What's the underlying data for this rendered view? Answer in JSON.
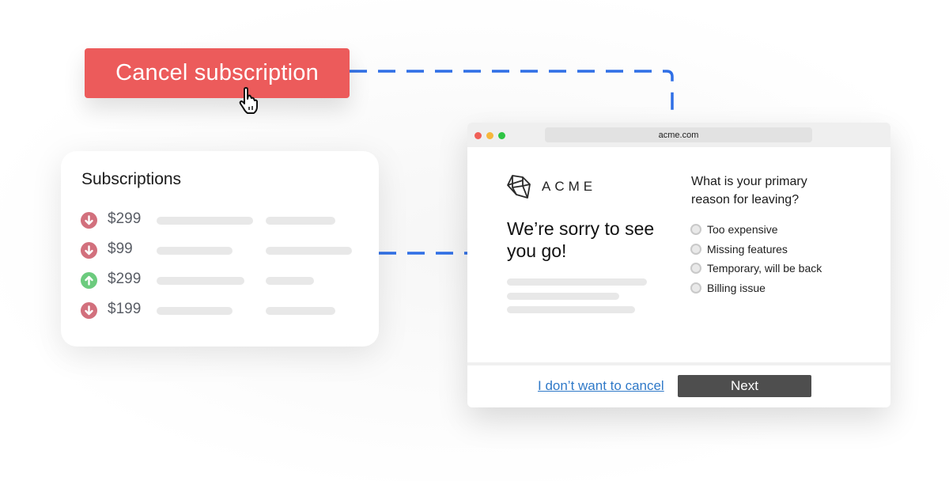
{
  "cta": {
    "cancel_label": "Cancel subscription",
    "color": "#ec5b5b"
  },
  "subscriptions": {
    "title": "Subscriptions",
    "rows": [
      {
        "direction": "down",
        "icon": "arrow-down-circle-icon",
        "price": "$299"
      },
      {
        "direction": "down",
        "icon": "arrow-down-circle-icon",
        "price": "$99"
      },
      {
        "direction": "up",
        "icon": "arrow-up-circle-icon",
        "price": "$299"
      },
      {
        "direction": "down",
        "icon": "arrow-down-circle-icon",
        "price": "$199"
      }
    ],
    "colors": {
      "down": "#d2707d",
      "up": "#6ccb7e"
    }
  },
  "browser": {
    "url": "acme.com",
    "window_controls": [
      "close",
      "minimize",
      "maximize"
    ],
    "brand": {
      "name": "ACME",
      "logo_icon": "polyhedron-logo-icon"
    },
    "headline": "We’re sorry to see you go!",
    "survey": {
      "question": "What is your primary reason for leaving?",
      "options": [
        "Too expensive",
        "Missing features",
        "Temporary, will be back",
        "Billing issue"
      ]
    },
    "footer": {
      "keep_label": "I don’t want to cancel",
      "next_label": "Next"
    }
  },
  "connector_color": "#2f6fe6"
}
